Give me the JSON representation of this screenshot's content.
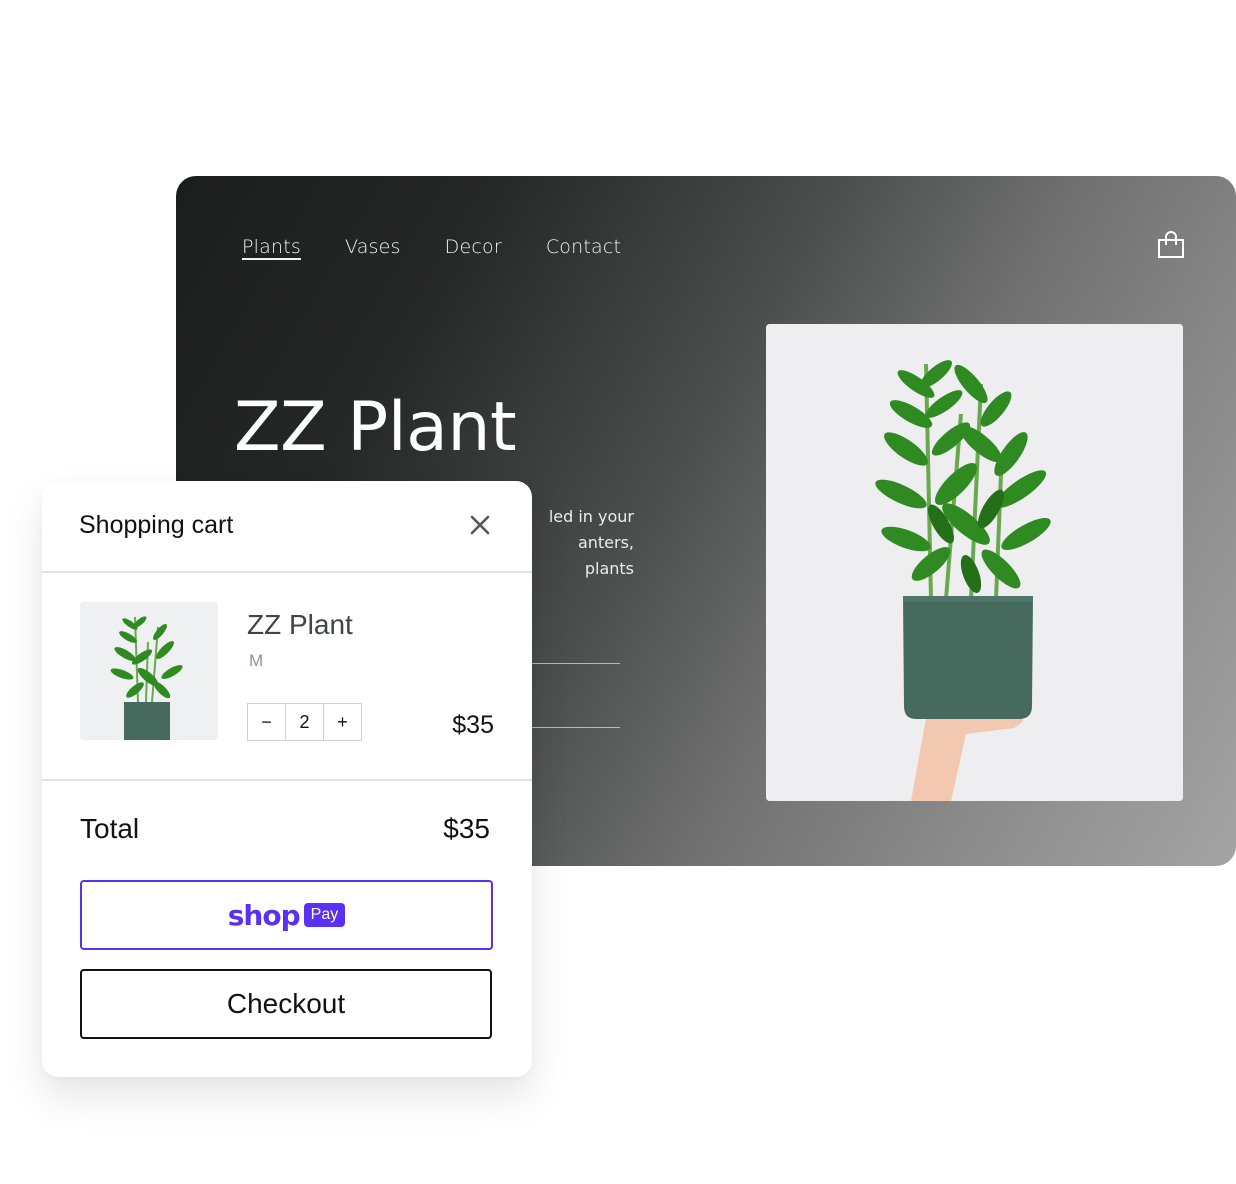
{
  "store": {
    "nav": [
      {
        "label": "Plants",
        "active": true
      },
      {
        "label": "Vases",
        "active": false
      },
      {
        "label": "Decor",
        "active": false
      },
      {
        "label": "Contact",
        "active": false
      }
    ],
    "cart_icon": "shopping-bag-icon",
    "hero": {
      "title": "ZZ Plant",
      "description_lines": [
        "led in your",
        "anters,",
        "plants"
      ],
      "image": "zz-plant-in-green-pot-held-by-hand"
    }
  },
  "cart": {
    "title": "Shopping cart",
    "close_icon": "close-icon",
    "item": {
      "name": "ZZ Plant",
      "variant": "M",
      "quantity": "2",
      "decrement_label": "−",
      "increment_label": "+",
      "price": "$35",
      "image": "zz-plant-thumbnail"
    },
    "total_label": "Total",
    "total_value": "$35",
    "shoppay": {
      "shop_label": "shop",
      "pay_label": "Pay"
    },
    "checkout_label": "Checkout"
  },
  "colors": {
    "shoppay_purple": "#5a31f4",
    "pot_green": "#466a5e",
    "leaf_green": "#2f8a22"
  }
}
